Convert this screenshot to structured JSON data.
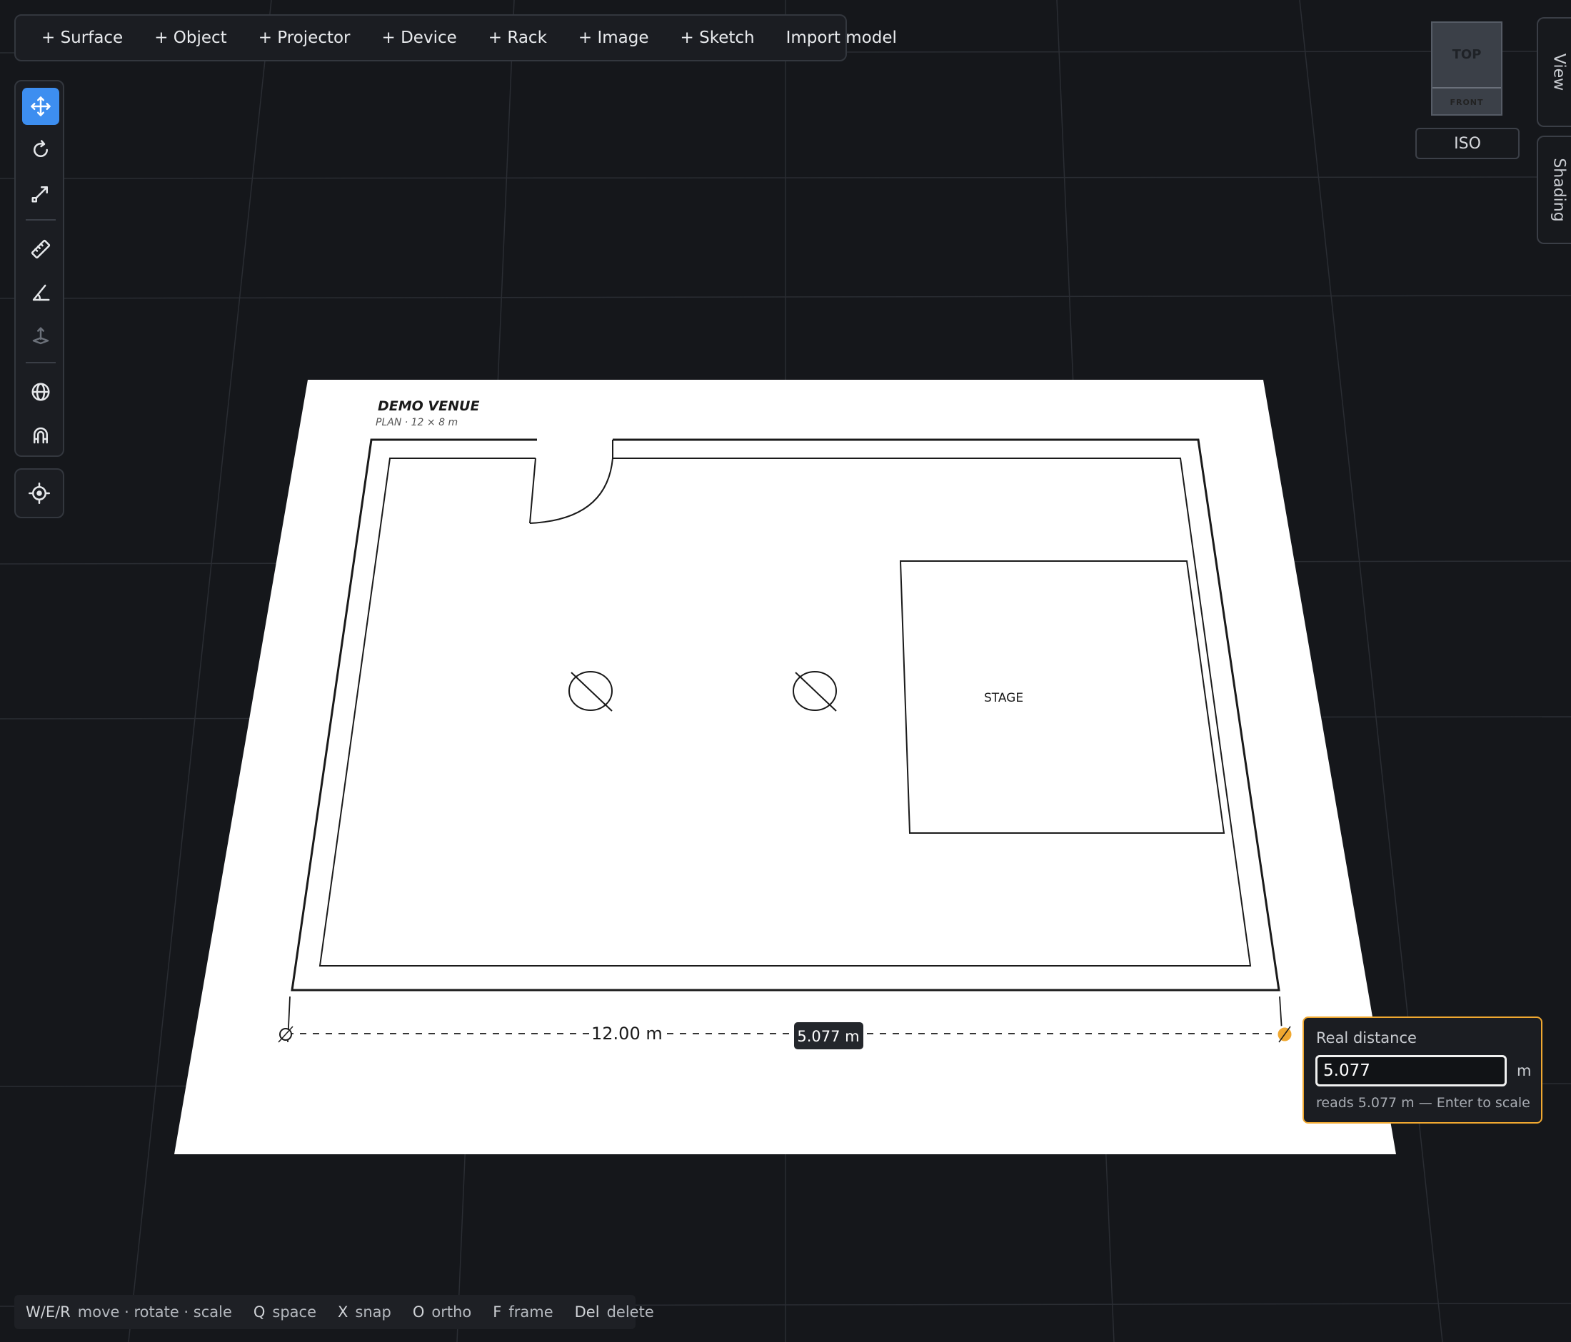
{
  "toolbar": {
    "surface": "+ Surface",
    "object": "+ Object",
    "projector": "+ Projector",
    "device": "+ Device",
    "rack": "+ Rack",
    "image": "+ Image",
    "sketch": "+ Sketch",
    "import": "Import model"
  },
  "tools": {
    "active": "move",
    "items": [
      "move",
      "rotate",
      "scale",
      "measure",
      "angle",
      "height",
      "globe",
      "magnet",
      "locate"
    ]
  },
  "viewcube": {
    "top": "TOP",
    "front": "FRONT",
    "iso": "ISO"
  },
  "side_tabs": {
    "view": "View",
    "shading": "Shading"
  },
  "plan": {
    "title": "DEMO VENUE",
    "subtitle": "PLAN · 12 × 8 m",
    "stage_label": "STAGE",
    "dimension_label": "12.00 m",
    "measure_readout": "5.077 m"
  },
  "distance_panel": {
    "title": "Real distance",
    "value": "5.077",
    "unit": "m",
    "hint": "reads 5.077 m — Enter to scale"
  },
  "shortcuts": [
    {
      "key": "W/E/R",
      "label": "move · rotate · scale"
    },
    {
      "key": "Q",
      "label": "space"
    },
    {
      "key": "X",
      "label": "snap"
    },
    {
      "key": "O",
      "label": "ortho"
    },
    {
      "key": "F",
      "label": "frame"
    },
    {
      "key": "Del",
      "label": "delete"
    }
  ],
  "colors": {
    "accent": "#3d8ef0",
    "highlight": "#f0a830",
    "background": "#15171b"
  }
}
